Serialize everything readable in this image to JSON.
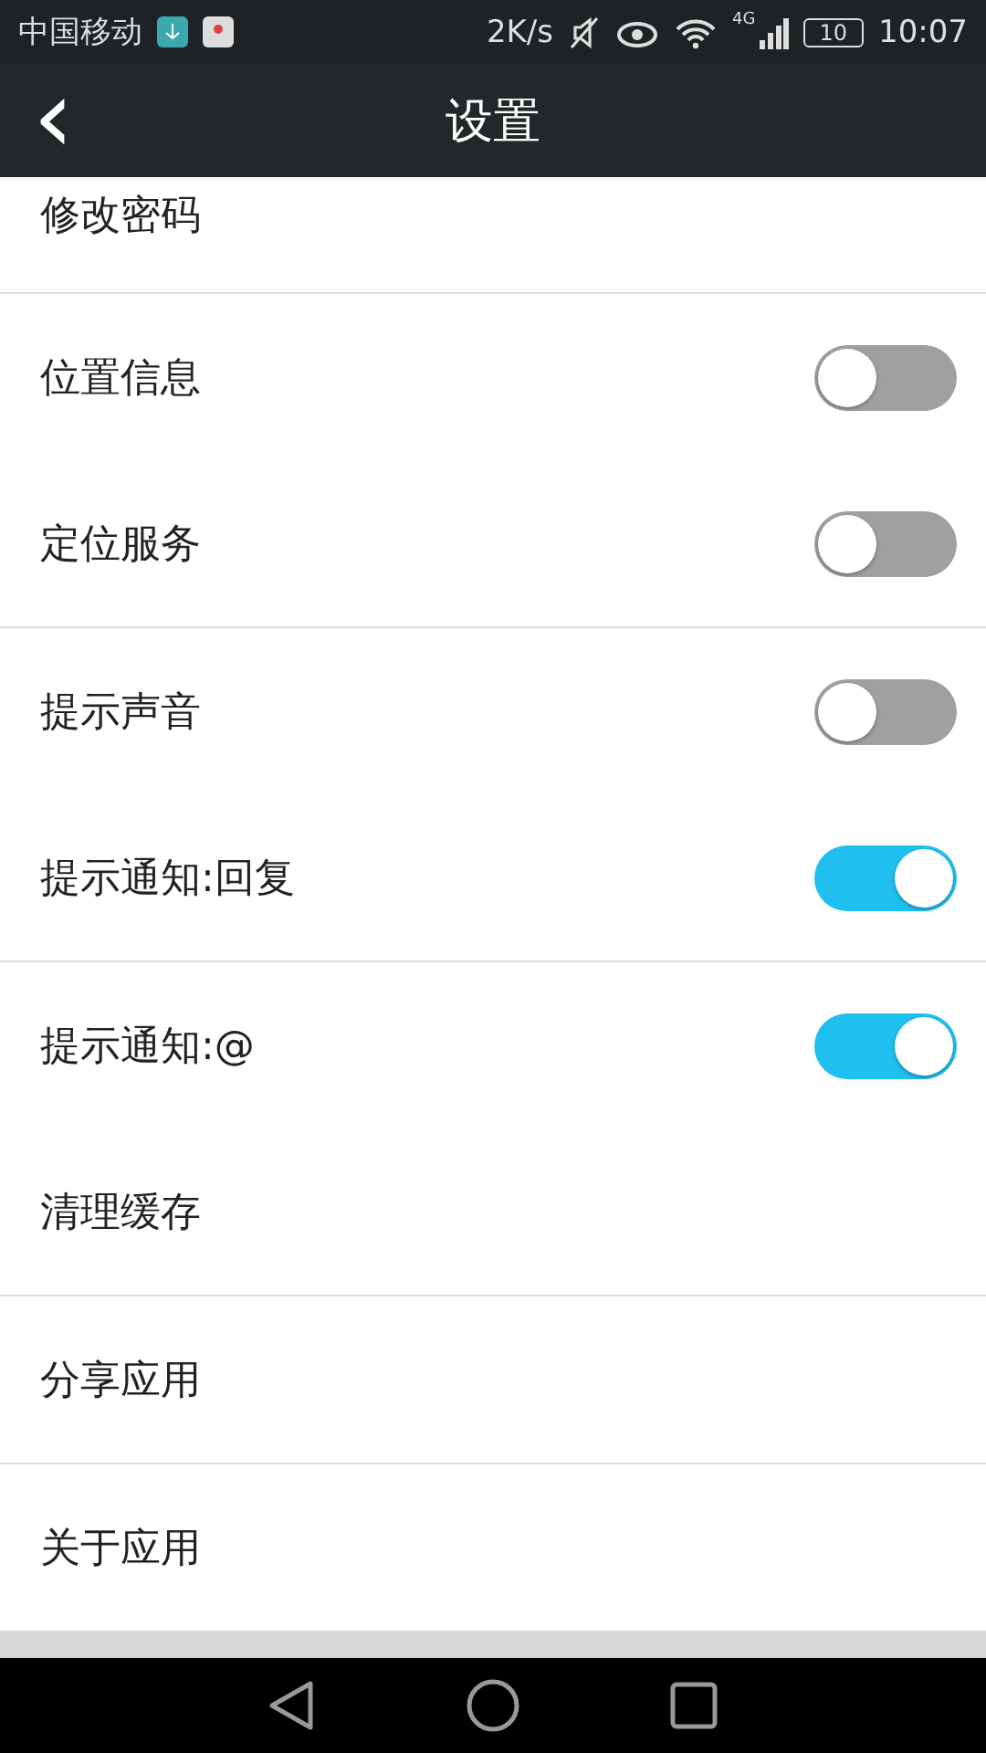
{
  "status_bar": {
    "carrier": "中国移动",
    "speed": "2K/s",
    "network": "4G",
    "battery": "10",
    "time": "10:07"
  },
  "toolbar": {
    "back": "‹",
    "title": "设置"
  },
  "groups": [
    {
      "items": [
        {
          "kind": "link",
          "label": "修改密码"
        }
      ]
    },
    {
      "items": [
        {
          "kind": "toggle",
          "label": "位置信息",
          "on": false
        },
        {
          "kind": "toggle",
          "label": "定位服务",
          "on": false
        }
      ]
    },
    {
      "items": [
        {
          "kind": "toggle",
          "label": "提示声音",
          "on": false
        },
        {
          "kind": "toggle",
          "label": "提示通知:回复",
          "on": true
        }
      ]
    },
    {
      "items": [
        {
          "kind": "toggle",
          "label": "提示通知:@",
          "on": true
        },
        {
          "kind": "link",
          "label": "清理缓存"
        }
      ]
    },
    {
      "items": [
        {
          "kind": "link",
          "label": "分享应用"
        }
      ]
    },
    {
      "items": [
        {
          "kind": "link",
          "label": "关于应用"
        }
      ]
    }
  ]
}
